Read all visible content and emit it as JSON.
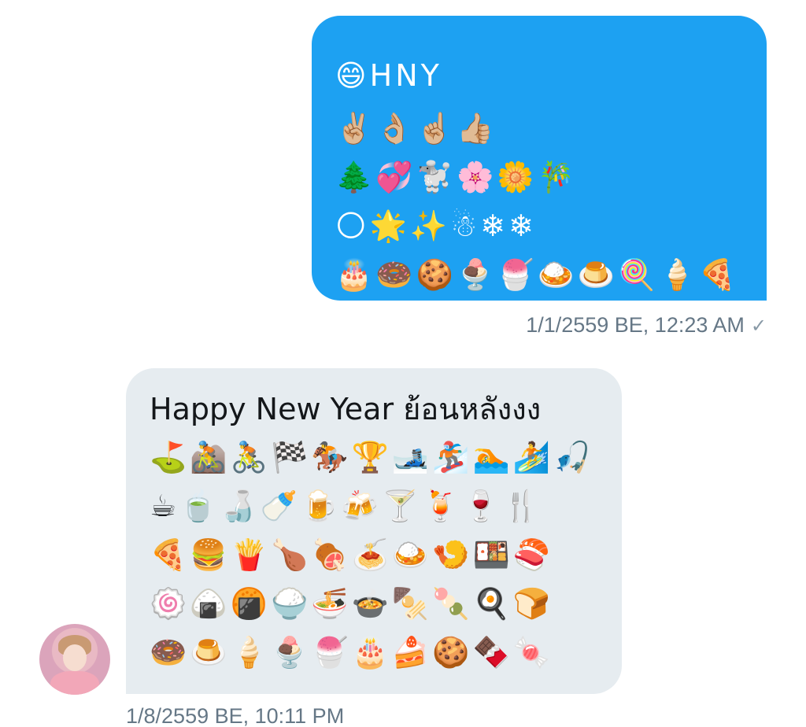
{
  "outgoing_message": {
    "lines": [
      "😄HNY",
      "✌🏼👌🏼☝🏼👍🏼",
      "🌲💞🐩🌸🌼🎋",
      "🌕🌟✨☃❄❄",
      "🎂🍩🍪🍨🍧🍛🍮🍭🍦🍕"
    ],
    "timestamp": "1/1/2559 BE, 12:23 AM",
    "read_mark": "✓"
  },
  "incoming_message": {
    "lines": [
      "Happy New Year ย้อนหลังงง",
      "⛳🚵🚴🏁🏇🏆🎿🏂🏊🏄🎣",
      "☕🍵🍶🍼🍺🍻🍸🍹🍷🍴",
      "🍕🍔🍟🍗🍖🍝🍛🍤🍱🍣",
      "🍥🍙🍘🍚🍜🍲🍢🍡🍳🍞",
      "🍩🍮🍦🍨🍧🎂🍰🍪🍫🍬"
    ],
    "timestamp": "1/8/2559 BE, 10:11 PM"
  },
  "colors": {
    "outgoing_bubble": "#1da1f2",
    "incoming_bubble": "#e6ecf0",
    "timestamp_text": "#657786"
  }
}
